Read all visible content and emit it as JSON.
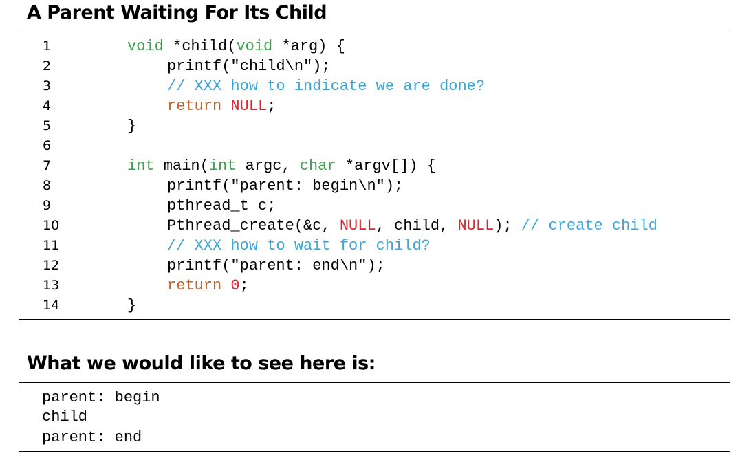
{
  "title": "A Parent Waiting For Its Child",
  "code": {
    "lines": [
      {
        "number": "1",
        "indent": 0,
        "tokens": [
          {
            "t": "void",
            "k": "type"
          },
          {
            "t": " *child(",
            "k": "plain"
          },
          {
            "t": "void",
            "k": "type"
          },
          {
            "t": " *arg) {",
            "k": "plain"
          }
        ]
      },
      {
        "number": "2",
        "indent": 1,
        "tokens": [
          {
            "t": "printf(\"child\\n\");",
            "k": "plain"
          }
        ]
      },
      {
        "number": "3",
        "indent": 1,
        "tokens": [
          {
            "t": "// XXX how to indicate we are done?",
            "k": "comment"
          }
        ]
      },
      {
        "number": "4",
        "indent": 1,
        "tokens": [
          {
            "t": "return",
            "k": "keyword"
          },
          {
            "t": " ",
            "k": "plain"
          },
          {
            "t": "NULL",
            "k": "literal"
          },
          {
            "t": ";",
            "k": "plain"
          }
        ]
      },
      {
        "number": "5",
        "indent": 0,
        "tokens": [
          {
            "t": "}",
            "k": "plain"
          }
        ]
      },
      {
        "number": "6",
        "indent": 0,
        "tokens": []
      },
      {
        "number": "7",
        "indent": 0,
        "tokens": [
          {
            "t": "int",
            "k": "type"
          },
          {
            "t": " main(",
            "k": "plain"
          },
          {
            "t": "int",
            "k": "type"
          },
          {
            "t": " argc, ",
            "k": "plain"
          },
          {
            "t": "char",
            "k": "type"
          },
          {
            "t": " *argv[]) {",
            "k": "plain"
          }
        ]
      },
      {
        "number": "8",
        "indent": 1,
        "tokens": [
          {
            "t": "printf(\"parent: begin\\n\");",
            "k": "plain"
          }
        ]
      },
      {
        "number": "9",
        "indent": 1,
        "tokens": [
          {
            "t": "pthread_t c;",
            "k": "plain"
          }
        ]
      },
      {
        "number": "10",
        "indent": 1,
        "tokens": [
          {
            "t": "Pthread_create(&c, ",
            "k": "plain"
          },
          {
            "t": "NULL",
            "k": "literal"
          },
          {
            "t": ", child, ",
            "k": "plain"
          },
          {
            "t": "NULL",
            "k": "literal"
          },
          {
            "t": "); ",
            "k": "plain"
          },
          {
            "t": "// create child",
            "k": "comment"
          }
        ]
      },
      {
        "number": "11",
        "indent": 1,
        "tokens": [
          {
            "t": "// XXX how to wait for child?",
            "k": "comment"
          }
        ]
      },
      {
        "number": "12",
        "indent": 1,
        "tokens": [
          {
            "t": "printf(\"parent: end\\n\");",
            "k": "plain"
          }
        ]
      },
      {
        "number": "13",
        "indent": 1,
        "tokens": [
          {
            "t": "return",
            "k": "keyword"
          },
          {
            "t": " ",
            "k": "plain"
          },
          {
            "t": "0",
            "k": "literal"
          },
          {
            "t": ";",
            "k": "plain"
          }
        ]
      },
      {
        "number": "14",
        "indent": 0,
        "tokens": [
          {
            "t": "}",
            "k": "plain"
          }
        ]
      }
    ]
  },
  "subtitle": "What we would like to see here is:",
  "output": {
    "lines": [
      "parent: begin",
      "child",
      "parent: end"
    ]
  },
  "colors": {
    "type": "#3fa34d",
    "keyword": "#c0622b",
    "literal": "#e0242b",
    "comment": "#3aa7d8",
    "text": "#000000",
    "border": "#000000"
  }
}
